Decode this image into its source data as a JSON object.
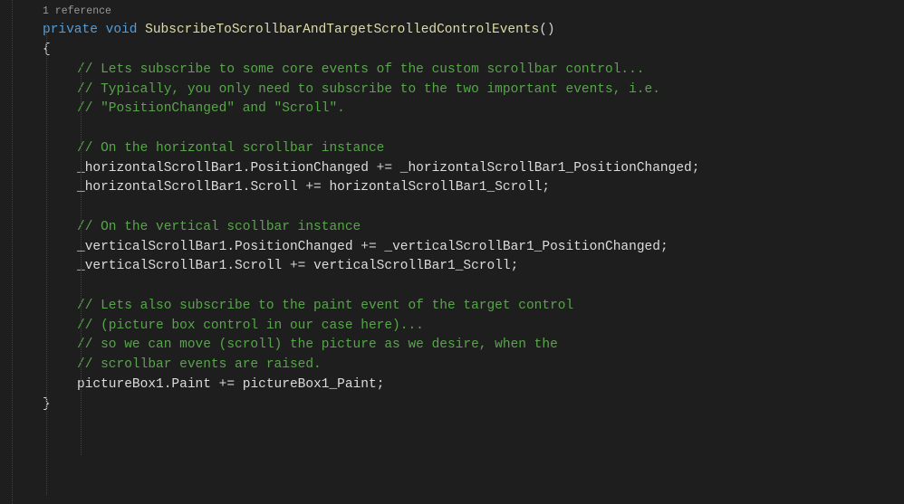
{
  "codelens": {
    "references": "1 reference"
  },
  "signature": {
    "modifier": "private",
    "returnType": "void",
    "methodName": "SubscribeToScrollbarAndTargetScrolledControlEvents",
    "params": "()"
  },
  "braces": {
    "open": "{",
    "close": "}"
  },
  "body": {
    "c1": "// Lets subscribe to some core events of the custom scrollbar control...",
    "c2": "// Typically, you only need to subscribe to the two important events, i.e.",
    "c3": "// \"PositionChanged\" and \"Scroll\".",
    "c4": "// On the horizontal scrollbar instance",
    "l5a": "_horizontalScrollBar1",
    "l5b": "PositionChanged",
    "l5c": "_horizontalScrollBar1_PositionChanged",
    "l6a": "_horizontalScrollBar1",
    "l6b": "Scroll",
    "l6c": "horizontalScrollBar1_Scroll",
    "c7": "// On the vertical scollbar instance",
    "l8a": "_verticalScrollBar1",
    "l8b": "PositionChanged",
    "l8c": "_verticalScrollBar1_PositionChanged",
    "l9a": "_verticalScrollBar1",
    "l9b": "Scroll",
    "l9c": "verticalScrollBar1_Scroll",
    "c10": "// Lets also subscribe to the paint event of the target control",
    "c11": "// (picture box control in our case here)...",
    "c12": "// so we can move (scroll) the picture as we desire, when the",
    "c13": "// scrollbar events are raised.",
    "l14a": "pictureBox1",
    "l14b": "Paint",
    "l14c": "pictureBox1_Paint",
    "dot": ".",
    "pluseq": " += ",
    "semi": ";"
  }
}
